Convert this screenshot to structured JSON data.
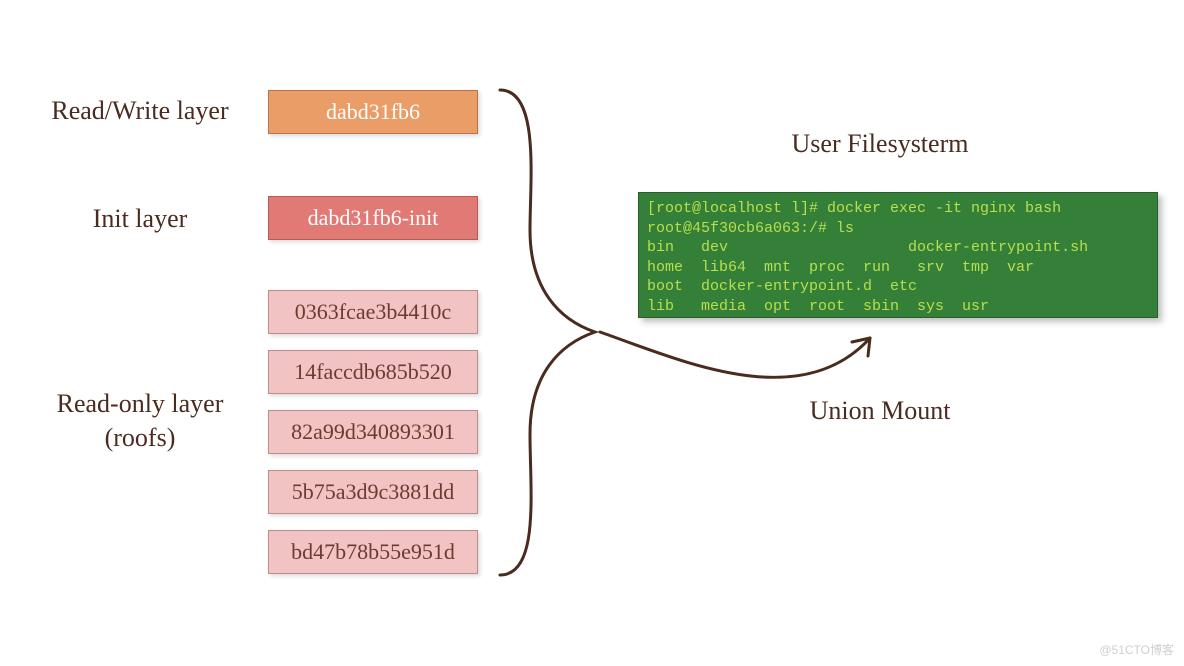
{
  "labels": {
    "rw": "Read/Write layer",
    "init": "Init layer",
    "ro1": "Read-only layer",
    "ro2": "(roofs)",
    "user_fs": "User Filesysterm",
    "union": "Union Mount"
  },
  "layers": {
    "rw": "dabd31fb6",
    "init": "dabd31fb6-init",
    "ro": [
      "0363fcae3b4410c",
      "14faccdb685b520",
      "82a99d340893301",
      "5b75a3d9c3881dd",
      "bd47b78b55e951d"
    ]
  },
  "terminal": {
    "l1": "[root@localhost l]# docker exec -it nginx bash",
    "l2": "root@45f30cb6a063:/# ls",
    "l3": "bin   dev                    docker-entrypoint.sh",
    "l4": "home  lib64  mnt  proc  run   srv  tmp  var",
    "l5": "boot  docker-entrypoint.d  etc",
    "l6": "lib   media  opt  root  sbin  sys  usr"
  },
  "watermark": "@51CTO博客"
}
